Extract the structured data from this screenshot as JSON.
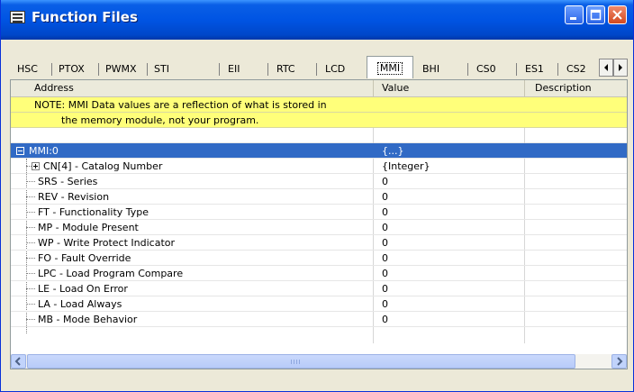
{
  "window": {
    "title": "Function Files"
  },
  "tabs": [
    {
      "label": "HSC"
    },
    {
      "label": "PTOX"
    },
    {
      "label": "PWMX"
    },
    {
      "label": "STI"
    },
    {
      "label": "EII"
    },
    {
      "label": "RTC"
    },
    {
      "label": "LCD"
    },
    {
      "label": "MMI"
    },
    {
      "label": "BHI"
    },
    {
      "label": "CS0"
    },
    {
      "label": "ES1"
    },
    {
      "label": "CS2"
    }
  ],
  "active_tab": "MMI",
  "columns": {
    "address": "Address",
    "value": "Value",
    "description": "Description"
  },
  "note": {
    "line1": "NOTE: MMI Data values are a reflection of what is stored in",
    "line2": "the memory module, not your program."
  },
  "root": {
    "address": "MMI:0",
    "value": "{...}"
  },
  "rows": [
    {
      "address": "CN[4] - Catalog Number",
      "value": "{Integer}"
    },
    {
      "address": "SRS - Series",
      "value": "0"
    },
    {
      "address": "REV - Revision",
      "value": "0"
    },
    {
      "address": "FT - Functionality Type",
      "value": "0"
    },
    {
      "address": "MP - Module Present",
      "value": "0"
    },
    {
      "address": "WP - Write Protect Indicator",
      "value": "0"
    },
    {
      "address": "FO - Fault Override",
      "value": "0"
    },
    {
      "address": "LPC - Load Program Compare",
      "value": "0"
    },
    {
      "address": "LE - Load On Error",
      "value": "0"
    },
    {
      "address": "LA - Load Always",
      "value": "0"
    },
    {
      "address": "MB - Mode Behavior",
      "value": "0"
    }
  ],
  "colors": {
    "titlebar": "#0054e3",
    "selection": "#316ac5",
    "note_bg": "#ffff7a"
  }
}
